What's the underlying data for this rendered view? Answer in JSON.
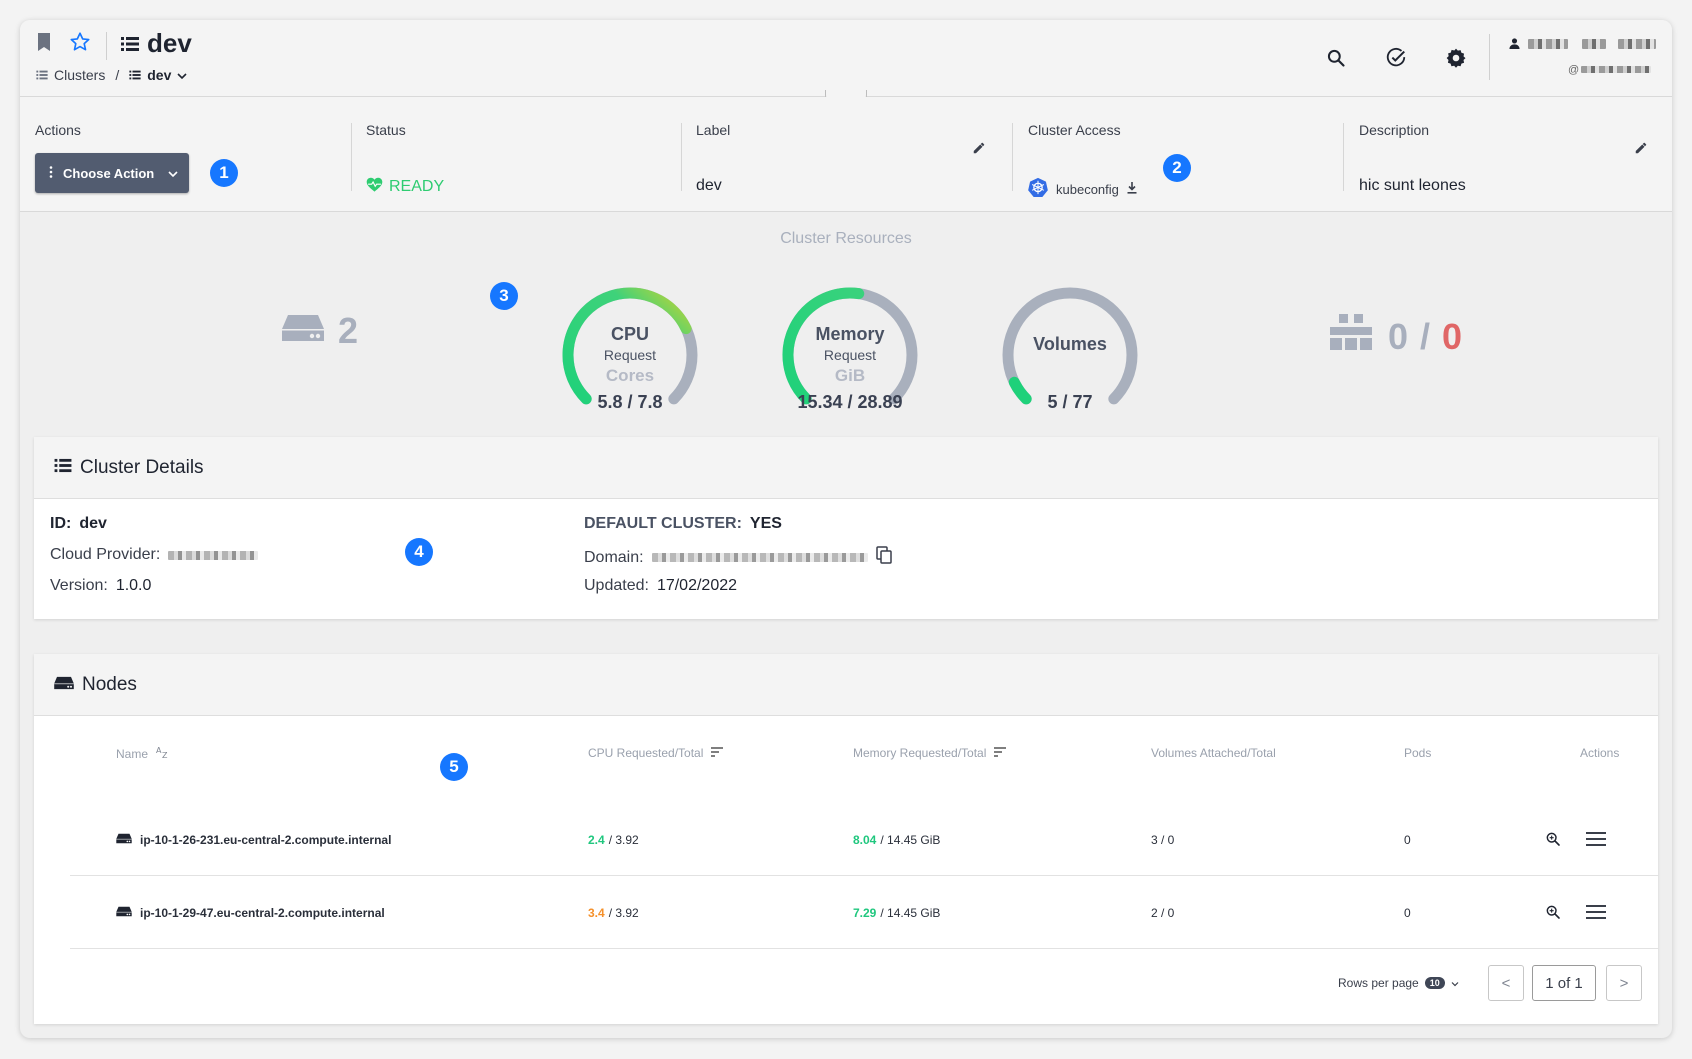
{
  "header": {
    "title": "dev",
    "breadcrumb": {
      "root": "Clusters",
      "separator": "/",
      "current": "dev"
    },
    "user_handle_prefix": "@"
  },
  "info": {
    "actions_label": "Actions",
    "choose_action": "Choose Action",
    "status_label": "Status",
    "status_value": "READY",
    "label_label": "Label",
    "label_value": "dev",
    "access_label": "Cluster Access",
    "access_value": "kubeconfig",
    "description_label": "Description",
    "description_value": "hic sunt leones"
  },
  "markers": [
    "1",
    "2",
    "3",
    "4",
    "5"
  ],
  "resources": {
    "title": "Cluster Resources",
    "nodes": "2",
    "cpu": {
      "title": "CPU",
      "sub": "Request",
      "unit": "Cores",
      "value": "5.8 / 7.8",
      "fraction": 0.74
    },
    "memory": {
      "title": "Memory",
      "sub": "Request",
      "unit": "GiB",
      "value": "15.34 / 28.89",
      "fraction": 0.53
    },
    "volumes": {
      "title": "Volumes",
      "value": "5 / 77",
      "fraction": 0.07
    },
    "pods_running": "0",
    "pods_sep": "/",
    "pods_failed": "0"
  },
  "details": {
    "title": "Cluster Details",
    "id_label": "ID:",
    "id_value": "dev",
    "provider_label": "Cloud Provider:",
    "version_label": "Version:",
    "version_value": "1.0.0",
    "default_label": "DEFAULT CLUSTER:",
    "default_value": "YES",
    "domain_label": "Domain:",
    "updated_label": "Updated:",
    "updated_value": "17/02/2022"
  },
  "nodes": {
    "title": "Nodes",
    "columns": [
      "Name",
      "CPU Requested/Total",
      "Memory Requested/Total",
      "Volumes Attached/Total",
      "Pods",
      "Actions"
    ],
    "rows": [
      {
        "name": "ip-10-1-26-231.eu-central-2.compute.internal",
        "cpu_req": "2.4",
        "cpu_total": "/ 3.92",
        "mem_req": "8.04",
        "mem_total": "/ 14.45 GiB",
        "volumes": "3 / 0",
        "pods": "0"
      },
      {
        "name": "ip-10-1-29-47.eu-central-2.compute.internal",
        "cpu_req": "3.4",
        "cpu_total": "/ 3.92",
        "mem_req": "7.29",
        "mem_total": "/ 14.45 GiB",
        "volumes": "2 / 0",
        "pods": "0"
      }
    ],
    "rows_per_page_label": "Rows per page",
    "rows_per_page": "10",
    "page": "1 of 1",
    "prev": "<",
    "next": ">"
  },
  "colors": {
    "accent": "#1677ff",
    "ready": "#2ecc71",
    "danger": "#e06666",
    "gauge_track": "#a9b0bd"
  }
}
